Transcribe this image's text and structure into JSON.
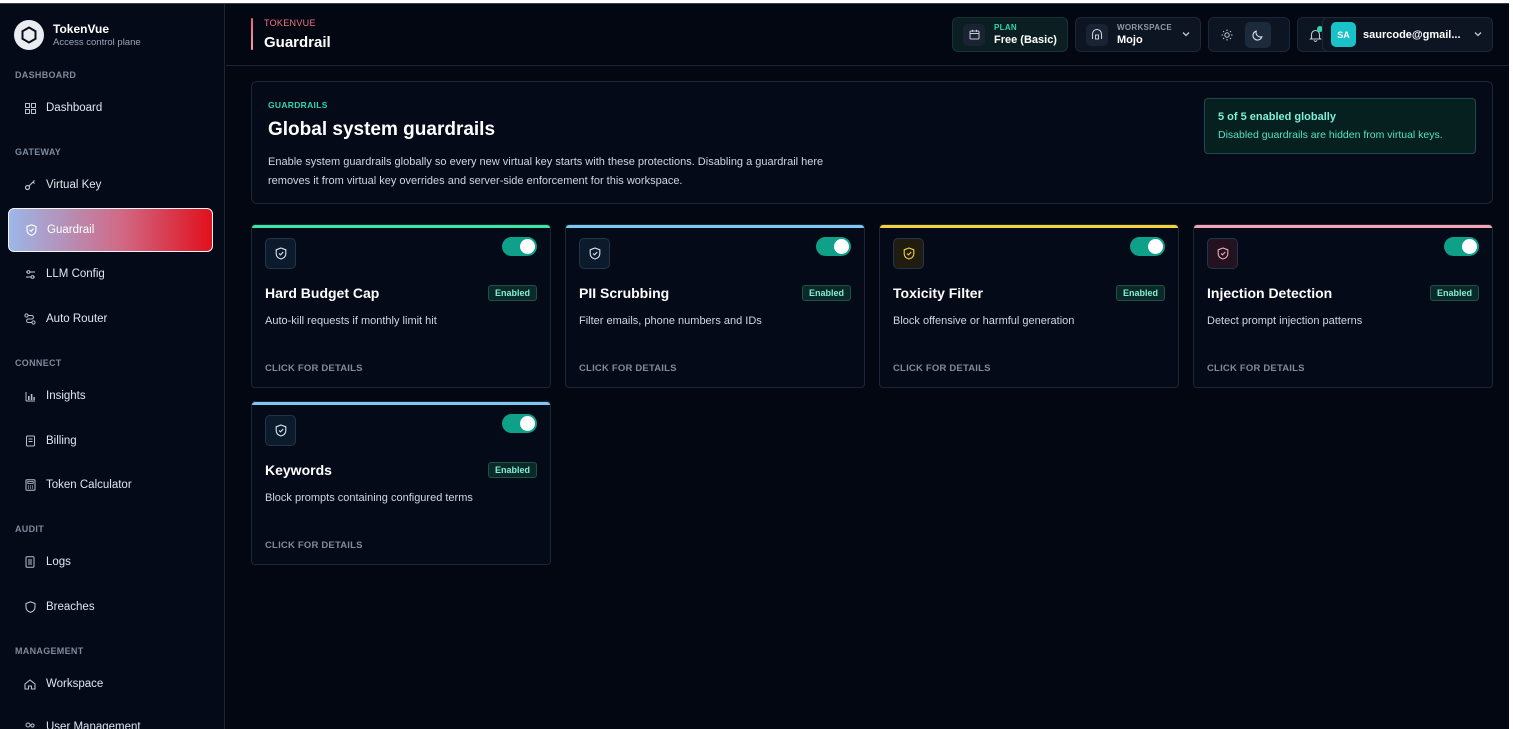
{
  "brand": {
    "name": "TokenVue",
    "subtitle": "Access control plane"
  },
  "sidebar": {
    "sections": [
      {
        "label": "DASHBOARD",
        "items": [
          {
            "label": "Dashboard",
            "icon": "grid-icon"
          }
        ]
      },
      {
        "label": "GATEWAY",
        "items": [
          {
            "label": "Virtual Key",
            "icon": "key-icon"
          },
          {
            "label": "Guardrail",
            "icon": "shield-icon",
            "active": true
          },
          {
            "label": "LLM Config",
            "icon": "sliders-icon"
          },
          {
            "label": "Auto Router",
            "icon": "route-icon"
          }
        ]
      },
      {
        "label": "CONNECT",
        "items": [
          {
            "label": "Insights",
            "icon": "bar-chart-icon"
          },
          {
            "label": "Billing",
            "icon": "receipt-icon"
          },
          {
            "label": "Token Calculator",
            "icon": "calculator-icon"
          }
        ]
      },
      {
        "label": "AUDIT",
        "items": [
          {
            "label": "Logs",
            "icon": "file-icon"
          },
          {
            "label": "Breaches",
            "icon": "shield-alert-icon"
          }
        ]
      },
      {
        "label": "MANAGEMENT",
        "items": [
          {
            "label": "Workspace",
            "icon": "home-icon"
          },
          {
            "label": "User Management",
            "icon": "users-icon"
          }
        ]
      }
    ]
  },
  "header": {
    "breadcrumb": "TOKENVUE",
    "title": "Guardrail",
    "plan": {
      "label": "PLAN",
      "value": "Free (Basic)"
    },
    "workspace": {
      "label": "WORKSPACE",
      "value": "Mojo"
    },
    "user": {
      "initials": "SA",
      "email": "saurcode@gmail..."
    }
  },
  "hero": {
    "kicker": "GUARDRAILS",
    "title": "Global system guardrails",
    "description": "Enable system guardrails globally so every new virtual key starts with these protections. Disabling a guardrail here removes it from virtual key overrides and server-side enforcement for this workspace.",
    "badge_title": "5 of 5 enabled globally",
    "badge_text": "Disabled guardrails are hidden from virtual keys."
  },
  "cards": [
    {
      "name": "Hard Budget Cap",
      "status": "Enabled",
      "description": "Auto-kill requests if monthly limit hit",
      "details": "CLICK FOR DETAILS",
      "accent": "#3ee6a4",
      "icon_color": "#d9e3ef",
      "icon_bg": "#0c1b2b",
      "enabled": true
    },
    {
      "name": "PII Scrubbing",
      "status": "Enabled",
      "description": "Filter emails, phone numbers and IDs",
      "details": "CLICK FOR DETAILS",
      "accent": "#7cc8f2",
      "icon_color": "#d9e3ef",
      "icon_bg": "#0c1b2b",
      "enabled": true
    },
    {
      "name": "Toxicity Filter",
      "status": "Enabled",
      "description": "Block offensive or harmful generation",
      "details": "CLICK FOR DETAILS",
      "accent": "#f2d13c",
      "icon_color": "#f2d13c",
      "icon_bg": "#201d10",
      "enabled": true
    },
    {
      "name": "Injection Detection",
      "status": "Enabled",
      "description": "Detect prompt injection patterns",
      "details": "CLICK FOR DETAILS",
      "accent": "#f4a3b5",
      "icon_color": "#f0a8b8",
      "icon_bg": "#231320",
      "enabled": true
    },
    {
      "name": "Keywords",
      "status": "Enabled",
      "description": "Block prompts containing configured terms",
      "details": "CLICK FOR DETAILS",
      "accent": "#7cc8f2",
      "icon_color": "#d9e3ef",
      "icon_bg": "#0c1b2b",
      "enabled": true
    }
  ]
}
